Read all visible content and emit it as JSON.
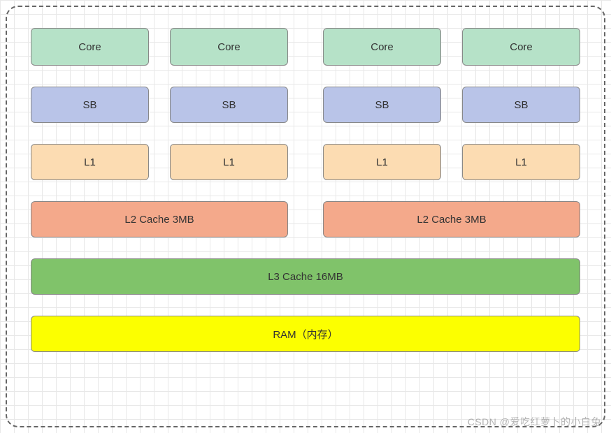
{
  "cores": {
    "labels": [
      "Core",
      "Core",
      "Core",
      "Core"
    ]
  },
  "sb": {
    "labels": [
      "SB",
      "SB",
      "SB",
      "SB"
    ]
  },
  "l1": {
    "labels": [
      "L1",
      "L1",
      "L1",
      "L1"
    ]
  },
  "l2": {
    "left_label": "L2 Cache 3MB",
    "right_label": "L2 Cache 3MB"
  },
  "l3": {
    "label": "L3 Cache 16MB"
  },
  "ram": {
    "label": "RAM（内存）"
  },
  "watermark": "CSDN @爱吃红萝卜的小白兔",
  "colors": {
    "core": "#b6e2c8",
    "sb": "#b9c4e8",
    "l1": "#fcdcb2",
    "l2": "#f4a98b",
    "l3": "#80c36a",
    "ram": "#fcff00"
  }
}
